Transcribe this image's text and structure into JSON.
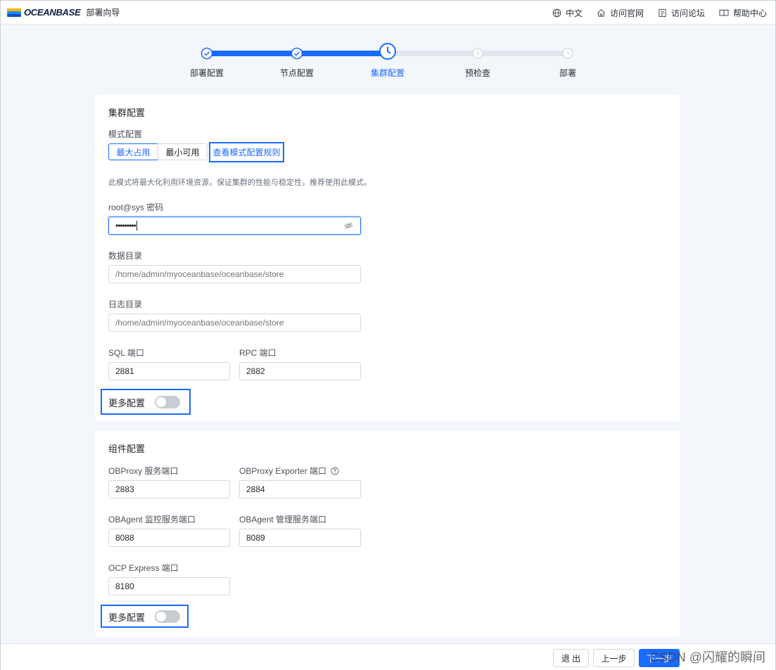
{
  "header": {
    "logo_text": "OCEANBASE",
    "subtitle": "部署向导",
    "links": [
      {
        "icon": "globe-icon",
        "label": "中文"
      },
      {
        "icon": "home-icon",
        "label": "访问官网"
      },
      {
        "icon": "forum-icon",
        "label": "访问论坛"
      },
      {
        "icon": "book-icon",
        "label": "帮助中心"
      }
    ]
  },
  "steps": [
    {
      "label": "部署配置",
      "status": "done"
    },
    {
      "label": "节点配置",
      "status": "done"
    },
    {
      "label": "集群配置",
      "status": "active"
    },
    {
      "label": "预检查",
      "status": "pending"
    },
    {
      "label": "部署",
      "status": "pending"
    }
  ],
  "cluster": {
    "title": "集群配置",
    "mode_label": "模式配置",
    "mode_options": [
      "最大占用",
      "最小可用"
    ],
    "mode_selected": "最大占用",
    "mode_rules_link": "查看模式配置规则",
    "mode_hint": "此模式将最大化利用环境资源，保证集群的性能与稳定性，推荐使用此模式。",
    "password_label": "root@sys 密码",
    "password_value": "•••••••••",
    "data_dir_label": "数据目录",
    "data_dir_placeholder": "/home/admin/myoceanbase/oceanbase/store",
    "log_dir_label": "日志目录",
    "log_dir_placeholder": "/home/admin/myoceanbase/oceanbase/store",
    "sql_port_label": "SQL 端口",
    "sql_port_value": "2881",
    "rpc_port_label": "RPC 端口",
    "rpc_port_value": "2882",
    "more_label": "更多配置",
    "more_enabled": false
  },
  "components": {
    "title": "组件配置",
    "obproxy_port_label": "OBProxy 服务端口",
    "obproxy_port_value": "2883",
    "obproxy_exporter_label": "OBProxy Exporter 端口",
    "obproxy_exporter_value": "2884",
    "obagent_monitor_label": "OBAgent 监控服务端口",
    "obagent_monitor_value": "8088",
    "obagent_manage_label": "OBAgent 管理服务端口",
    "obagent_manage_value": "8089",
    "ocp_express_label": "OCP Express 端口",
    "ocp_express_value": "8180",
    "more_label": "更多配置",
    "more_enabled": false
  },
  "footer": {
    "exit_label": "退 出",
    "prev_label": "上一步",
    "next_label": "下一步"
  },
  "watermark": "CSDN @闪耀的瞬间",
  "colors": {
    "accent": "#1a6bff",
    "background": "#f3f6fb"
  }
}
